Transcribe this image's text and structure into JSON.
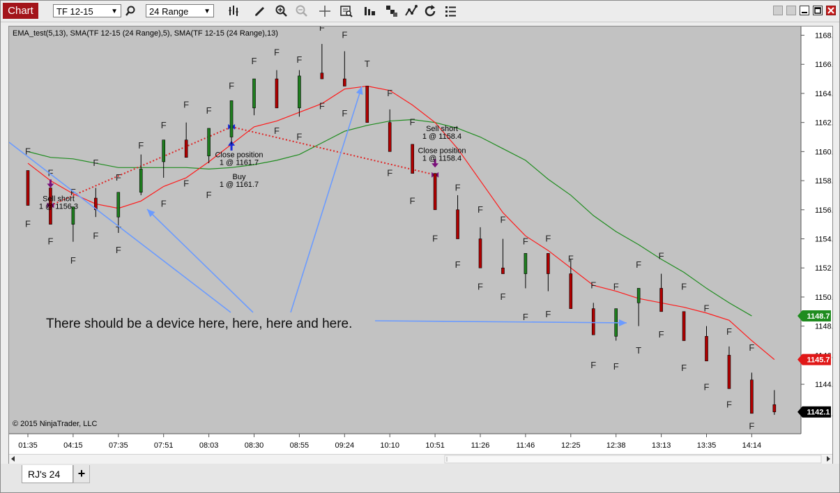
{
  "toolbar": {
    "chart_tab": "Chart",
    "instrument": "TF 12-15",
    "interval": "24 Range",
    "icons": [
      "search-icon",
      "bars-type-icon",
      "pencil-icon",
      "zoom-in-icon",
      "zoom-out-icon",
      "crosshair-icon",
      "data-box-icon",
      "chart-trader-icon",
      "strategies-icon",
      "indicators-icon",
      "reload-icon",
      "properties-icon"
    ]
  },
  "window_controls": [
    "tile-button",
    "tile-button",
    "minimize-button",
    "maximize-button",
    "close-button"
  ],
  "chart": {
    "legend": "EMA_test(5,13), SMA(TF 12-15 (24 Range),5), SMA(TF 12-15 (24 Range),13)",
    "copyright": "© 2015 NinjaTrader, LLC",
    "annotation": "There should be a device here, here, here and here.",
    "badges": [
      {
        "value": "1148.7",
        "color": "#1f8c1f"
      },
      {
        "value": "1145.7",
        "color": "#e01818"
      },
      {
        "value": "1142.1",
        "color": "#000000"
      }
    ],
    "trade_labels": [
      {
        "lines": [
          "Sell short",
          "1 @ 1156.3"
        ],
        "x": 71,
        "y": 1156.6
      },
      {
        "lines": [
          "Close position",
          "1 @ 1161.7"
        ],
        "x": 330,
        "y": 1159.6
      },
      {
        "lines": [
          "Buy",
          "1 @ 1161.7"
        ],
        "x": 330,
        "y": 1158.1
      },
      {
        "lines": [
          "Sell short",
          "1 @ 1158.4"
        ],
        "x": 621,
        "y": 1161.4
      },
      {
        "lines": [
          "Close position",
          "1 @ 1158.4"
        ],
        "x": 621,
        "y": 1159.9
      }
    ],
    "colors": {
      "background": "#c2c2c2",
      "up": "#1e7d1e",
      "down": "#b00000",
      "ema": "#ff1a1a",
      "sma13": "#1e8c1e",
      "annotation_arrow": "#6b9bff",
      "trade_line": "#e02020"
    }
  },
  "chart_data": {
    "type": "candlestick",
    "y_axis_ticks": [
      1168.0,
      1166.0,
      1164.0,
      1162.0,
      1160.0,
      1158.0,
      1156.0,
      1154.0,
      1152.0,
      1150.0,
      1148.0,
      1146.0,
      1144.0,
      1142.0
    ],
    "ylim": [
      1140.6,
      1168.6
    ],
    "x_ticks": [
      {
        "label": "01:35",
        "bar": 0
      },
      {
        "label": "04:15",
        "bar": 2
      },
      {
        "label": "07:35",
        "bar": 4
      },
      {
        "label": "07:51",
        "bar": 6
      },
      {
        "label": "08:03",
        "bar": 8
      },
      {
        "label": "08:30",
        "bar": 10
      },
      {
        "label": "08:55",
        "bar": 12
      },
      {
        "label": "09:24",
        "bar": 14
      },
      {
        "label": "10:10",
        "bar": 16
      },
      {
        "label": "10:51",
        "bar": 18
      },
      {
        "label": "11:26",
        "bar": 20
      },
      {
        "label": "11:46",
        "bar": 22
      },
      {
        "label": "12:25",
        "bar": 24
      },
      {
        "label": "12:38",
        "bar": 26
      },
      {
        "label": "13:13",
        "bar": 28
      },
      {
        "label": "13:35",
        "bar": 30
      },
      {
        "label": "14:14",
        "bar": 32
      }
    ],
    "candles": [
      {
        "o": 1158.7,
        "h": 1158.7,
        "l": 1156.3,
        "c": 1156.3
      },
      {
        "o": 1157.5,
        "h": 1157.5,
        "l": 1155.0,
        "c": 1155.0
      },
      {
        "o": 1155.0,
        "h": 1156.2,
        "l": 1153.8,
        "c": 1156.2
      },
      {
        "o": 1156.8,
        "h": 1157.5,
        "l": 1155.5,
        "c": 1156.0
      },
      {
        "o": 1155.5,
        "h": 1157.2,
        "l": 1154.7,
        "c": 1157.2
      },
      {
        "o": 1157.2,
        "h": 1159.8,
        "l": 1157.0,
        "c": 1158.8
      },
      {
        "o": 1159.3,
        "h": 1160.8,
        "l": 1158.2,
        "c": 1160.8
      },
      {
        "o": 1160.8,
        "h": 1162.0,
        "l": 1159.6,
        "c": 1159.6
      },
      {
        "o": 1159.7,
        "h": 1161.6,
        "l": 1159.2,
        "c": 1161.6
      },
      {
        "o": 1161.0,
        "h": 1163.5,
        "l": 1160.5,
        "c": 1163.5
      },
      {
        "o": 1163.0,
        "h": 1165.0,
        "l": 1162.5,
        "c": 1165.0
      },
      {
        "o": 1165.0,
        "h": 1165.6,
        "l": 1163.0,
        "c": 1163.0
      },
      {
        "o": 1163.0,
        "h": 1165.6,
        "l": 1162.4,
        "c": 1165.2
      },
      {
        "o": 1165.4,
        "h": 1167.4,
        "l": 1165.0,
        "c": 1165.0
      },
      {
        "o": 1165.0,
        "h": 1166.9,
        "l": 1164.5,
        "c": 1164.5
      },
      {
        "o": 1164.5,
        "h": 1164.5,
        "l": 1162.0,
        "c": 1162.0
      },
      {
        "o": 1162.0,
        "h": 1162.9,
        "l": 1160.0,
        "c": 1160.0
      },
      {
        "o": 1160.5,
        "h": 1160.5,
        "l": 1158.5,
        "c": 1158.5
      },
      {
        "o": 1158.5,
        "h": 1158.5,
        "l": 1156.0,
        "c": 1156.0
      },
      {
        "o": 1156.0,
        "h": 1157.0,
        "l": 1154.0,
        "c": 1154.0
      },
      {
        "o": 1154.0,
        "h": 1154.8,
        "l": 1152.0,
        "c": 1152.0
      },
      {
        "o": 1152.0,
        "h": 1154.0,
        "l": 1151.6,
        "c": 1151.6
      },
      {
        "o": 1151.6,
        "h": 1153.0,
        "l": 1150.6,
        "c": 1153.0
      },
      {
        "o": 1153.0,
        "h": 1153.0,
        "l": 1150.4,
        "c": 1151.6
      },
      {
        "o": 1151.6,
        "h": 1152.6,
        "l": 1149.2,
        "c": 1149.2
      },
      {
        "o": 1149.2,
        "h": 1149.6,
        "l": 1147.4,
        "c": 1147.4
      },
      {
        "o": 1147.3,
        "h": 1149.2,
        "l": 1147.0,
        "c": 1149.2
      },
      {
        "o": 1149.6,
        "h": 1150.6,
        "l": 1148.0,
        "c": 1150.6
      },
      {
        "o": 1150.6,
        "h": 1151.6,
        "l": 1149.0,
        "c": 1149.0
      },
      {
        "o": 1149.0,
        "h": 1149.0,
        "l": 1147.0,
        "c": 1147.0
      },
      {
        "o": 1147.3,
        "h": 1148.0,
        "l": 1145.6,
        "c": 1145.6
      },
      {
        "o": 1146.0,
        "h": 1146.6,
        "l": 1143.7,
        "c": 1143.7
      },
      {
        "o": 1144.3,
        "h": 1144.8,
        "l": 1142.0,
        "c": 1142.0
      },
      {
        "o": 1142.6,
        "h": 1143.6,
        "l": 1141.9,
        "c": 1142.1
      }
    ],
    "series": [
      {
        "name": "EMA_test(5,13)",
        "color": "#ff1a1a",
        "values": [
          1159.2,
          1158.0,
          1157.1,
          1156.4,
          1156.1,
          1156.6,
          1157.6,
          1158.2,
          1159.3,
          1160.5,
          1161.7,
          1162.1,
          1162.7,
          1163.3,
          1164.3,
          1164.5,
          1164.2,
          1163.2,
          1162.0,
          1160.2,
          1158.0,
          1155.8,
          1154.2,
          1153.2,
          1152.0,
          1150.8,
          1150.4,
          1149.9,
          1149.6,
          1149.3,
          1148.9,
          1148.4,
          1147.0,
          1145.7
        ]
      },
      {
        "name": "SMA(TF 12-15 (24 Range),13)",
        "color": "#1e8c1e",
        "values": [
          1160.0,
          1159.6,
          1159.5,
          1159.2,
          1158.9,
          1158.9,
          1158.9,
          1158.9,
          1158.8,
          1158.9,
          1159.1,
          1159.4,
          1159.8,
          1160.6,
          1161.4,
          1161.8,
          1162.1,
          1162.2,
          1162.0,
          1161.6,
          1161.0,
          1160.2,
          1159.4,
          1158.1,
          1157.0,
          1155.6,
          1154.5,
          1153.6,
          1152.6,
          1151.7,
          1150.6,
          1149.6,
          1148.7
        ]
      }
    ],
    "f_labels": [
      [
        0,
        1160.0
      ],
      [
        0,
        1155.0
      ],
      [
        1,
        1158.5
      ],
      [
        1,
        1153.8
      ],
      [
        2,
        1157.2
      ],
      [
        2,
        1152.5
      ],
      [
        3,
        1159.2
      ],
      [
        3,
        1154.2
      ],
      [
        4,
        1158.2
      ],
      [
        4,
        1153.2
      ],
      [
        5,
        1160.4
      ],
      [
        6,
        1161.8
      ],
      [
        6,
        1156.4
      ],
      [
        7,
        1163.2
      ],
      [
        7,
        1157.8
      ],
      [
        8,
        1162.8
      ],
      [
        8,
        1157.0
      ],
      [
        9,
        1164.5
      ],
      [
        10,
        1166.2
      ],
      [
        11,
        1166.8
      ],
      [
        11,
        1161.4
      ],
      [
        12,
        1166.3
      ],
      [
        12,
        1161.0
      ],
      [
        13,
        1168.5
      ],
      [
        13,
        1163.1
      ],
      [
        14,
        1168.0
      ],
      [
        14,
        1162.6
      ],
      [
        16,
        1164.0
      ],
      [
        16,
        1158.5
      ],
      [
        17,
        1162.0
      ],
      [
        17,
        1156.6
      ],
      [
        18,
        1154.0
      ],
      [
        19,
        1157.5
      ],
      [
        19,
        1152.2
      ],
      [
        20,
        1156.0
      ],
      [
        20,
        1150.7
      ],
      [
        21,
        1155.3
      ],
      [
        21,
        1150.0
      ],
      [
        22,
        1153.8
      ],
      [
        22,
        1148.6
      ],
      [
        23,
        1154.0
      ],
      [
        23,
        1148.8
      ],
      [
        24,
        1152.6
      ],
      [
        25,
        1150.8
      ],
      [
        25,
        1145.3
      ],
      [
        26,
        1150.7
      ],
      [
        26,
        1145.2
      ],
      [
        27,
        1152.2
      ],
      [
        28,
        1152.8
      ],
      [
        28,
        1147.4
      ],
      [
        29,
        1150.7
      ],
      [
        29,
        1145.1
      ],
      [
        30,
        1149.2
      ],
      [
        30,
        1143.8
      ],
      [
        31,
        1147.6
      ],
      [
        31,
        1142.6
      ],
      [
        32,
        1146.5
      ],
      [
        32,
        1141.1
      ]
    ],
    "t_labels": [
      [
        4,
        1154.6
      ],
      [
        15,
        1166.0
      ],
      [
        27,
        1146.3
      ]
    ]
  }
}
